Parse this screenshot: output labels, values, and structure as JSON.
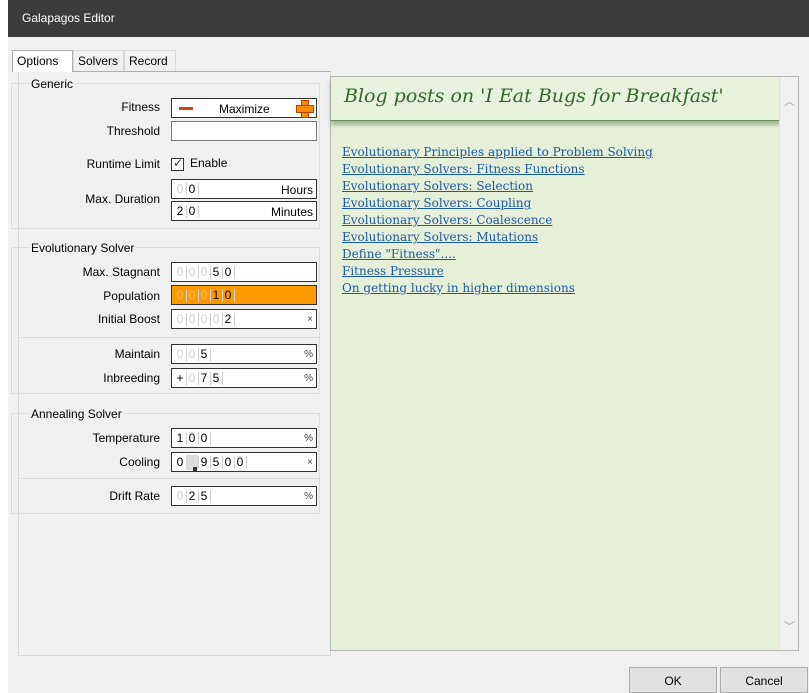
{
  "window": {
    "title": "Galapagos Editor"
  },
  "tabs": [
    {
      "label": "Options",
      "active": true
    },
    {
      "label": "Solvers",
      "active": false
    },
    {
      "label": "Record",
      "active": false
    }
  ],
  "generic": {
    "title": "Generic",
    "fitness": {
      "label": "Fitness",
      "value": "Maximize",
      "minus_icon": "minus-icon",
      "plus_icon": "plus-icon"
    },
    "threshold": {
      "label": "Threshold",
      "value": ""
    },
    "runtime_limit": {
      "label": "Runtime Limit",
      "checkbox_label": "Enable",
      "checked": true
    },
    "max_duration": {
      "label": "Max. Duration",
      "hours": {
        "digits": [
          "0",
          "0"
        ],
        "unit": "Hours"
      },
      "minutes": {
        "digits": [
          "2",
          "0"
        ],
        "unit": "Minutes"
      }
    }
  },
  "evolutionary": {
    "title": "Evolutionary Solver",
    "max_stagnant": {
      "label": "Max. Stagnant",
      "digits": [
        "0",
        "0",
        "0",
        "5",
        "0"
      ]
    },
    "population": {
      "label": "Population",
      "digits": [
        "0",
        "0",
        "0",
        "1",
        "0"
      ],
      "highlight_color": "#ff9900"
    },
    "initial_boost": {
      "label": "Initial Boost",
      "digits": [
        "0",
        "0",
        "0",
        "0",
        "2"
      ],
      "unit": "×"
    },
    "maintain": {
      "label": "Maintain",
      "digits": [
        "0",
        "0",
        "5"
      ],
      "unit": "%"
    },
    "inbreeding": {
      "label": "Inbreeding",
      "sign": "+",
      "digits": [
        "0",
        "7",
        "5"
      ],
      "unit": "%"
    }
  },
  "annealing": {
    "title": "Annealing Solver",
    "temperature": {
      "label": "Temperature",
      "digits": [
        "1",
        "0",
        "0"
      ],
      "unit": "%"
    },
    "cooling": {
      "label": "Cooling",
      "digits": [
        "0",
        "",
        "9",
        "5",
        "0",
        "0"
      ],
      "unit": "×"
    },
    "drift_rate": {
      "label": "Drift Rate",
      "digits": [
        "0",
        "2",
        "5"
      ],
      "unit": "%"
    }
  },
  "blog": {
    "heading": "Blog posts on 'I Eat Bugs for Breakfast'",
    "links": [
      "Evolutionary Principles applied to Problem Solving",
      "Evolutionary Solvers: Fitness Functions",
      "Evolutionary Solvers: Selection",
      "Evolutionary Solvers: Coupling",
      "Evolutionary Solvers: Coalescence",
      "Evolutionary Solvers: Mutations",
      "Define \"Fitness\"....",
      "Fitness Pressure",
      "On getting lucky in higher dimensions"
    ],
    "background": "#e5efda",
    "link_color": "#1b5a9e",
    "heading_color": "#2f6a24"
  },
  "buttons": {
    "ok": "OK",
    "cancel": "Cancel"
  }
}
